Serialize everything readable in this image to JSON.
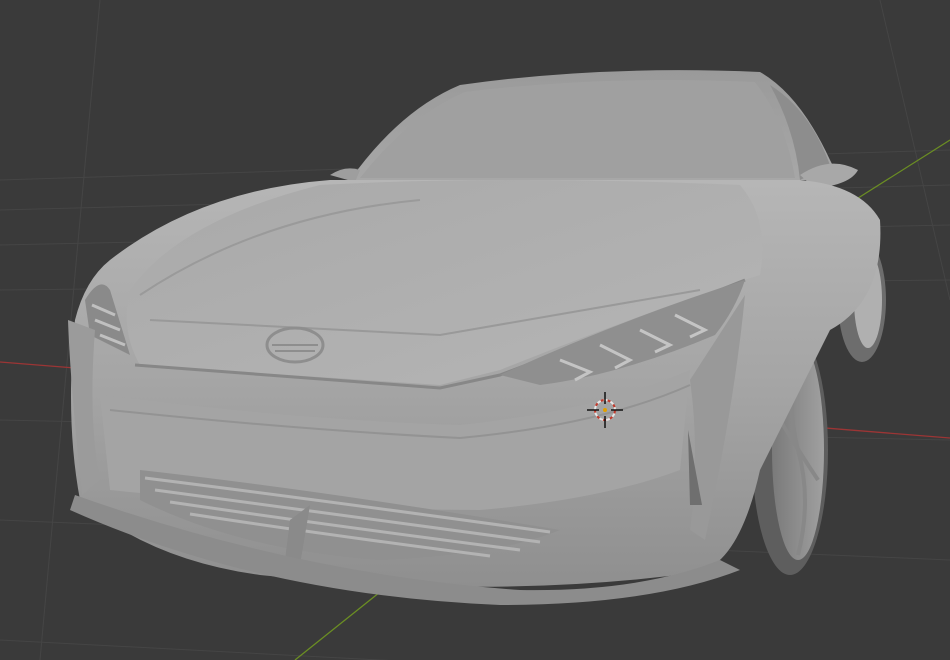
{
  "viewport": {
    "background_color": "#3a3a3a",
    "grid_color": "#444444",
    "x_axis_color": "#b23a3a",
    "y_axis_color": "#6b8e23",
    "model_color": "#a3a3a3",
    "cursor": {
      "name": "3d-cursor",
      "color_outer": "#d9d9d9",
      "color_accent": "#c0392b"
    }
  }
}
